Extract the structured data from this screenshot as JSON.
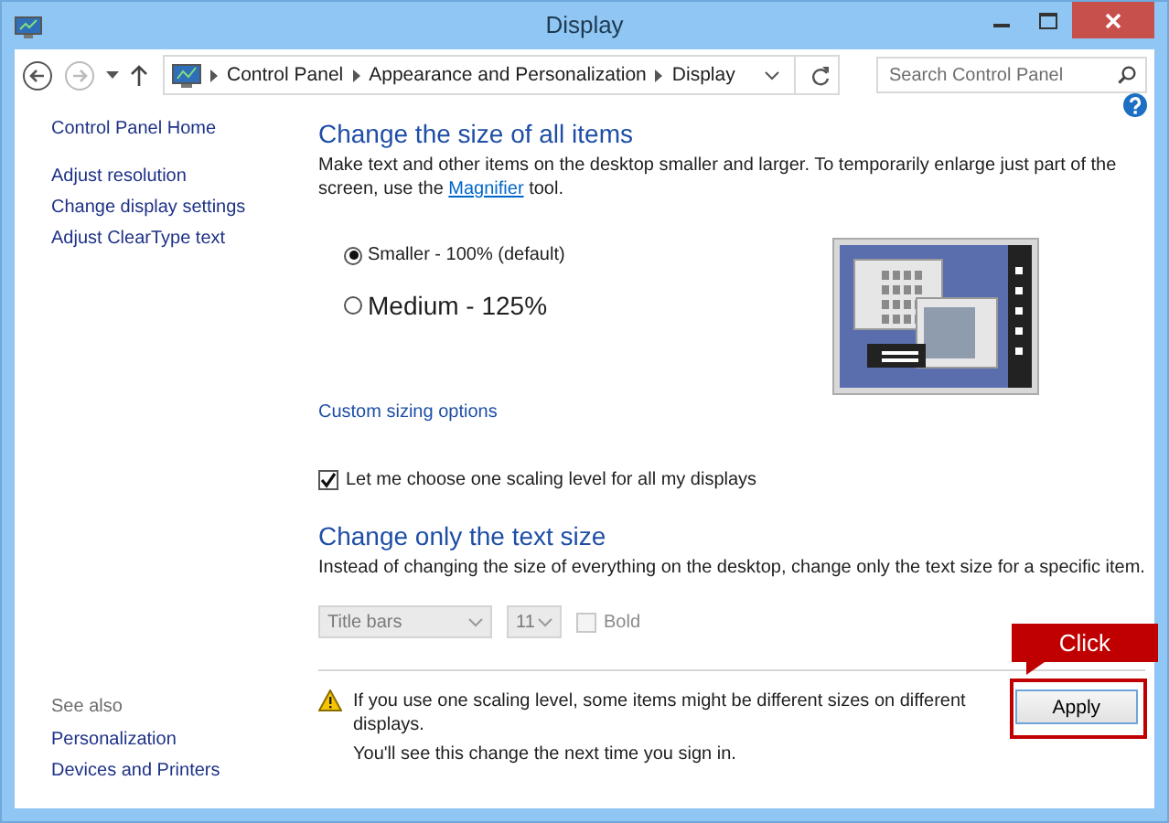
{
  "window": {
    "title": "Display"
  },
  "address_bar": {
    "breadcrumb": [
      "Control Panel",
      "Appearance and Personalization",
      "Display"
    ],
    "search_placeholder": "Search Control Panel"
  },
  "sidebar": {
    "home": "Control Panel Home",
    "links": [
      "Adjust resolution",
      "Change display settings",
      "Adjust ClearType text"
    ],
    "see_also_title": "See also",
    "see_also_links": [
      "Personalization",
      "Devices and Printers"
    ]
  },
  "size_section": {
    "heading": "Change the size of all items",
    "description": {
      "before": "Make text and other items on the desktop smaller and larger. To temporarily enlarge just part of the screen, use the ",
      "link": "Magnifier",
      "after": " tool."
    },
    "options": [
      {
        "label": "Smaller - 100% (default)",
        "selected": true,
        "kind": "small"
      },
      {
        "label": "Medium - 125%",
        "selected": false,
        "kind": "large"
      }
    ],
    "custom_link": "Custom sizing options",
    "scaling_checkbox": {
      "label": "Let me choose one scaling level for all my displays",
      "checked": true
    }
  },
  "text_section": {
    "heading": "Change only the text size",
    "description": "Instead of changing the size of everything on the desktop, change only the text size for a specific item.",
    "item_select": {
      "value": "Title bars",
      "disabled": true
    },
    "size_select": {
      "value": "11",
      "disabled": true
    },
    "bold_checkbox": {
      "label": "Bold",
      "checked": false,
      "disabled": true
    }
  },
  "warning": {
    "lines": [
      "If you use one scaling level, some items might be different sizes on different displays.",
      "You'll see this change the next time you sign in."
    ]
  },
  "apply_button": "Apply",
  "callout": {
    "label": "Click"
  }
}
